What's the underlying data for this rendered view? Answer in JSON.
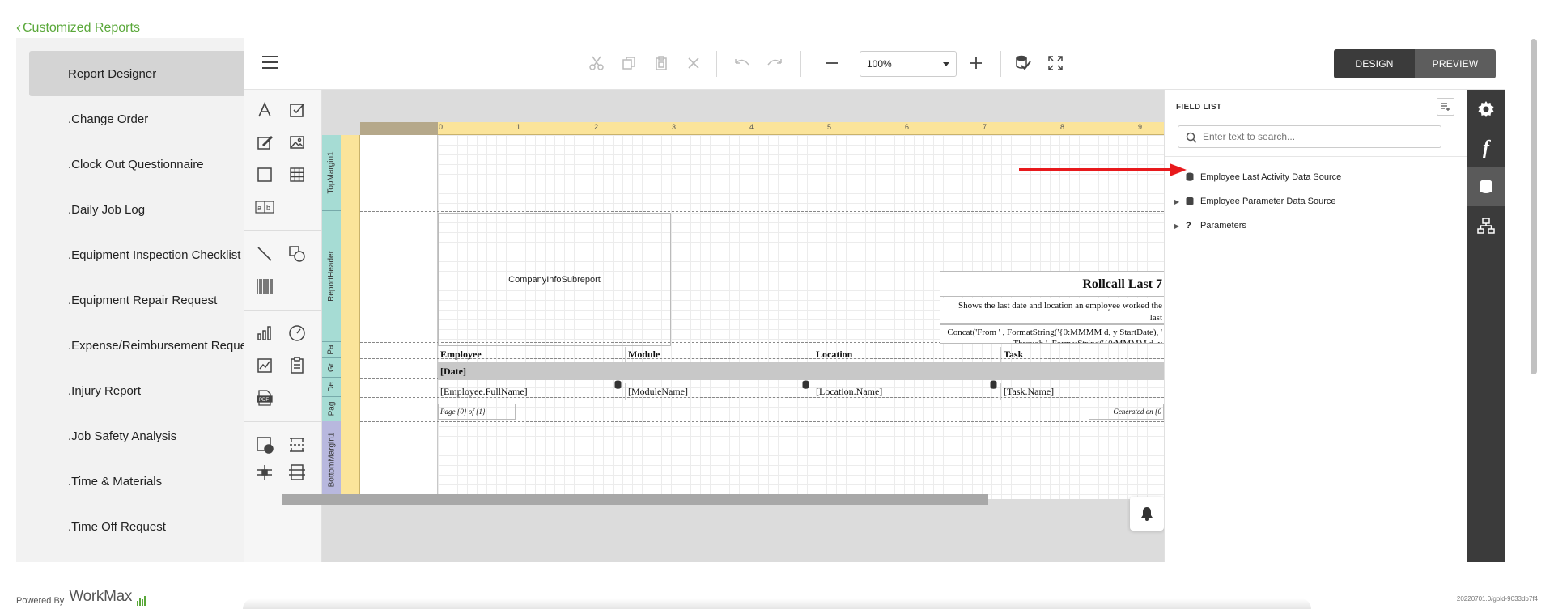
{
  "nav": {
    "back_label": "Customized Reports"
  },
  "reports": [
    {
      "label": "Report Designer",
      "active": true
    },
    {
      "label": ".Change Order"
    },
    {
      "label": ".Clock Out Questionnaire"
    },
    {
      "label": ".Daily Job Log"
    },
    {
      "label": ".Equipment Inspection Checklist"
    },
    {
      "label": ".Equipment Repair Request"
    },
    {
      "label": ".Expense/Reimbursement Request"
    },
    {
      "label": ".Injury Report"
    },
    {
      "label": ".Job Safety Analysis"
    },
    {
      "label": ".Time & Materials"
    },
    {
      "label": ".Time Off Request"
    }
  ],
  "toolbar": {
    "zoom": "100%",
    "design_label": "DESIGN",
    "preview_label": "PREVIEW"
  },
  "ruler": {
    "numbers": [
      "0",
      "1",
      "2",
      "3",
      "4",
      "5",
      "6",
      "7",
      "8",
      "9"
    ]
  },
  "bands": [
    "TopMargin1",
    "ReportHeader",
    "Pa",
    "Gr",
    "De",
    "Pag",
    "BottomMargin1"
  ],
  "report": {
    "subreport": "CompanyInfoSubreport",
    "title": "Rollcall Last 7",
    "description": "Shows the last date and location an employee worked the last",
    "concat": "Concat('From ' , FormatString('{0:MMMM d, y StartDate), ' Through ', FormatString('{0:MMMM d, y",
    "headers": [
      "Employee",
      "Module",
      "Location",
      "Task"
    ],
    "group": "[Date]",
    "details": [
      "[Employee.FullName]",
      "[ModuleName]",
      "[Location.Name]",
      "[Task.Name]"
    ],
    "page_info": "Page {0} of {1}",
    "generated": "Generated on {0"
  },
  "field_list": {
    "title": "FIELD LIST",
    "search_placeholder": "Enter text to search...",
    "items": [
      {
        "label": "Employee Last Activity Data Source",
        "expandable": false,
        "icon": "database-icon"
      },
      {
        "label": "Employee Parameter Data Source",
        "expandable": true,
        "icon": "database-icon"
      },
      {
        "label": "Parameters",
        "expandable": true,
        "icon": "question-icon"
      }
    ]
  },
  "footer": {
    "powered_by": "Powered By",
    "brand": "WorkMax",
    "version": "20220701.0/gold-9033db7f4"
  },
  "colors": {
    "accent_green": "#5aa83a",
    "arrow_red": "#e8191c",
    "dark_tab": "#3b3b3b"
  }
}
